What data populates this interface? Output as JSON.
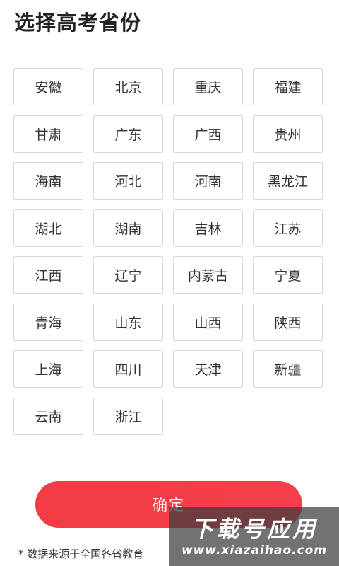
{
  "page_title": "选择高考省份",
  "provinces": [
    "安徽",
    "北京",
    "重庆",
    "福建",
    "甘肃",
    "广东",
    "广西",
    "贵州",
    "海南",
    "河北",
    "河南",
    "黑龙江",
    "湖北",
    "湖南",
    "吉林",
    "江苏",
    "江西",
    "辽宁",
    "内蒙古",
    "宁夏",
    "青海",
    "山东",
    "山西",
    "陕西",
    "上海",
    "四川",
    "天津",
    "新疆",
    "云南",
    "浙江"
  ],
  "confirm_label": "确定",
  "footnote": "* 数据来源于全国各省教育",
  "watermark": {
    "main": "下载号应用",
    "url": "www.xiazaihao.com"
  },
  "colors": {
    "accent": "#f23b45",
    "border": "#d9d9d9",
    "text": "#333333"
  }
}
